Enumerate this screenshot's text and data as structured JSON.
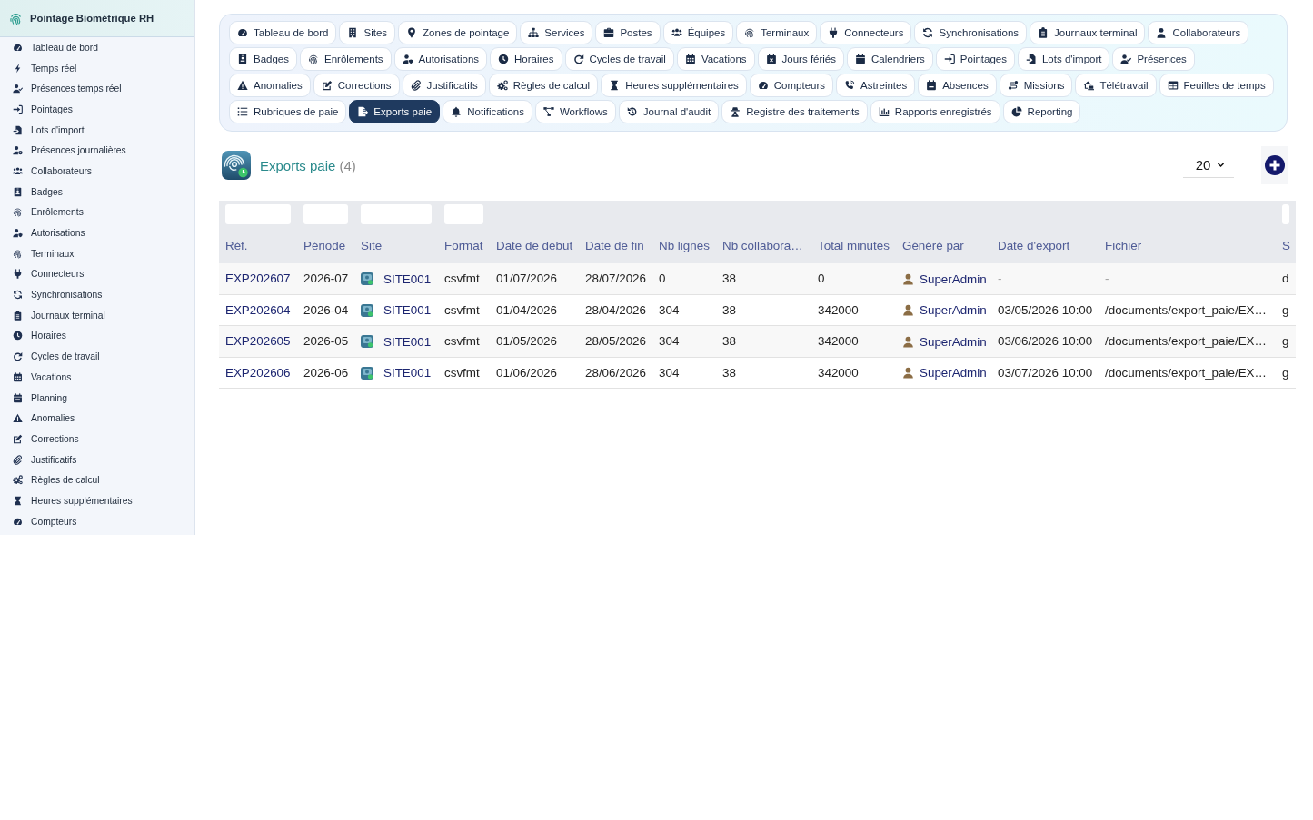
{
  "sidebar": {
    "title": "Pointage Biométrique RH",
    "items": [
      {
        "label": "Tableau de bord",
        "selected": false
      },
      {
        "label": "Temps réel",
        "selected": false
      },
      {
        "label": "Présences temps réel",
        "selected": false
      },
      {
        "label": "Pointages",
        "selected": false
      },
      {
        "label": "Lots d'import",
        "selected": false
      },
      {
        "label": "Présences journalières",
        "selected": false
      },
      {
        "label": "Collaborateurs",
        "selected": false
      },
      {
        "label": "Badges",
        "selected": false
      },
      {
        "label": "Enrôlements",
        "selected": false
      },
      {
        "label": "Autorisations",
        "selected": false
      },
      {
        "label": "Terminaux",
        "selected": false
      },
      {
        "label": "Connecteurs",
        "selected": false
      },
      {
        "label": "Synchronisations",
        "selected": false
      },
      {
        "label": "Journaux terminal",
        "selected": false
      },
      {
        "label": "Horaires",
        "selected": false
      },
      {
        "label": "Cycles de travail",
        "selected": false
      },
      {
        "label": "Vacations",
        "selected": false
      },
      {
        "label": "Planning",
        "selected": false
      },
      {
        "label": "Anomalies",
        "selected": false
      },
      {
        "label": "Corrections",
        "selected": false
      },
      {
        "label": "Justificatifs",
        "selected": false
      },
      {
        "label": "Règles de calcul",
        "selected": false
      },
      {
        "label": "Heures supplémentaires",
        "selected": false
      },
      {
        "label": "Compteurs",
        "selected": false
      }
    ]
  },
  "tab_rows": [
    [
      {
        "label": "Tableau de bord",
        "selected": false
      },
      {
        "label": "Sites",
        "selected": false
      },
      {
        "label": "Zones de pointage",
        "selected": false
      },
      {
        "label": "Services",
        "selected": false
      },
      {
        "label": "Postes",
        "selected": false
      },
      {
        "label": "Équipes",
        "selected": false
      },
      {
        "label": "Terminaux",
        "selected": false
      },
      {
        "label": "Connecteurs",
        "selected": false
      },
      {
        "label": "Synchronisations",
        "selected": false
      },
      {
        "label": "Journaux terminal",
        "selected": false
      },
      {
        "label": "Collaborateurs",
        "selected": false
      }
    ],
    [
      {
        "label": "Badges",
        "selected": false
      },
      {
        "label": "Enrôlements",
        "selected": false
      },
      {
        "label": "Autorisations",
        "selected": false
      },
      {
        "label": "Horaires",
        "selected": false
      },
      {
        "label": "Cycles de travail",
        "selected": false
      },
      {
        "label": "Vacations",
        "selected": false
      },
      {
        "label": "Jours fériés",
        "selected": false
      },
      {
        "label": "Calendriers",
        "selected": false
      },
      {
        "label": "Pointages",
        "selected": false
      },
      {
        "label": "Lots d'import",
        "selected": false
      },
      {
        "label": "Présences",
        "selected": false
      }
    ],
    [
      {
        "label": "Anomalies",
        "selected": false
      },
      {
        "label": "Corrections",
        "selected": false
      },
      {
        "label": "Justificatifs",
        "selected": false
      },
      {
        "label": "Règles de calcul",
        "selected": false
      },
      {
        "label": "Heures supplémentaires",
        "selected": false
      },
      {
        "label": "Compteurs",
        "selected": false
      },
      {
        "label": "Astreintes",
        "selected": false
      },
      {
        "label": "Absences",
        "selected": false
      },
      {
        "label": "Missions",
        "selected": false
      },
      {
        "label": "Télétravail",
        "selected": false
      },
      {
        "label": "Feuilles de temps",
        "selected": false
      }
    ],
    [
      {
        "label": "Rubriques de paie",
        "selected": false
      },
      {
        "label": "Exports paie",
        "selected": true
      },
      {
        "label": "Notifications",
        "selected": false
      },
      {
        "label": "Workflows",
        "selected": false
      },
      {
        "label": "Journal d'audit",
        "selected": false
      },
      {
        "label": "Registre des traitements",
        "selected": false
      },
      {
        "label": "Rapports enregistrés",
        "selected": false
      },
      {
        "label": "Reporting",
        "selected": false
      }
    ]
  ],
  "page": {
    "title": "Exports paie",
    "count": "(4)",
    "page_size": "20"
  },
  "table": {
    "columns": [
      {
        "label": "Réf.",
        "filter": true
      },
      {
        "label": "Période",
        "filter": true
      },
      {
        "label": "Site",
        "filter": true
      },
      {
        "label": "Format",
        "filter": true
      },
      {
        "label": "Date de début",
        "filter": false
      },
      {
        "label": "Date de fin",
        "filter": false
      },
      {
        "label": "Nb lignes",
        "filter": false
      },
      {
        "label": "Nb collabora…",
        "filter": false
      },
      {
        "label": "Total minutes",
        "filter": false
      },
      {
        "label": "Généré par",
        "filter": false
      },
      {
        "label": "Date d'export",
        "filter": false
      },
      {
        "label": "Fichier",
        "filter": false
      },
      {
        "label": "S",
        "filter": true
      }
    ],
    "rows": [
      {
        "ref": "EXP202607",
        "period": "2026-07",
        "site": "SITE001",
        "format": "csvfmt",
        "start_date": "01/07/2026",
        "end_date": "28/07/2026",
        "lines": "0",
        "employees": "38",
        "total_minutes": "0",
        "generated_by": "SuperAdmin",
        "export_date": {
          "text": "-",
          "greyed": true
        },
        "file": {
          "text": "-",
          "greyed": true
        },
        "column_13": "d"
      },
      {
        "ref": "EXP202604",
        "period": "2026-04",
        "site": "SITE001",
        "format": "csvfmt",
        "start_date": "01/04/2026",
        "end_date": "28/04/2026",
        "lines": "304",
        "employees": "38",
        "total_minutes": "342000",
        "generated_by": "SuperAdmin",
        "export_date": {
          "text": "03/05/2026 10:00",
          "greyed": false
        },
        "file": {
          "text": "/documents/export_paie/EX…",
          "greyed": false
        },
        "column_13": "g"
      },
      {
        "ref": "EXP202605",
        "period": "2026-05",
        "site": "SITE001",
        "format": "csvfmt",
        "start_date": "01/05/2026",
        "end_date": "28/05/2026",
        "lines": "304",
        "employees": "38",
        "total_minutes": "342000",
        "generated_by": "SuperAdmin",
        "export_date": {
          "text": "03/06/2026 10:00",
          "greyed": false
        },
        "file": {
          "text": "/documents/export_paie/EX…",
          "greyed": false
        },
        "column_13": "g"
      },
      {
        "ref": "EXP202606",
        "period": "2026-06",
        "site": "SITE001",
        "format": "csvfmt",
        "start_date": "01/06/2026",
        "end_date": "28/06/2026",
        "lines": "304",
        "employees": "38",
        "total_minutes": "342000",
        "generated_by": "SuperAdmin",
        "export_date": {
          "text": "03/07/2026 10:00",
          "greyed": false
        },
        "file": {
          "text": "/documents/export_paie/EX…",
          "greyed": false
        },
        "column_13": "g"
      }
    ]
  }
}
